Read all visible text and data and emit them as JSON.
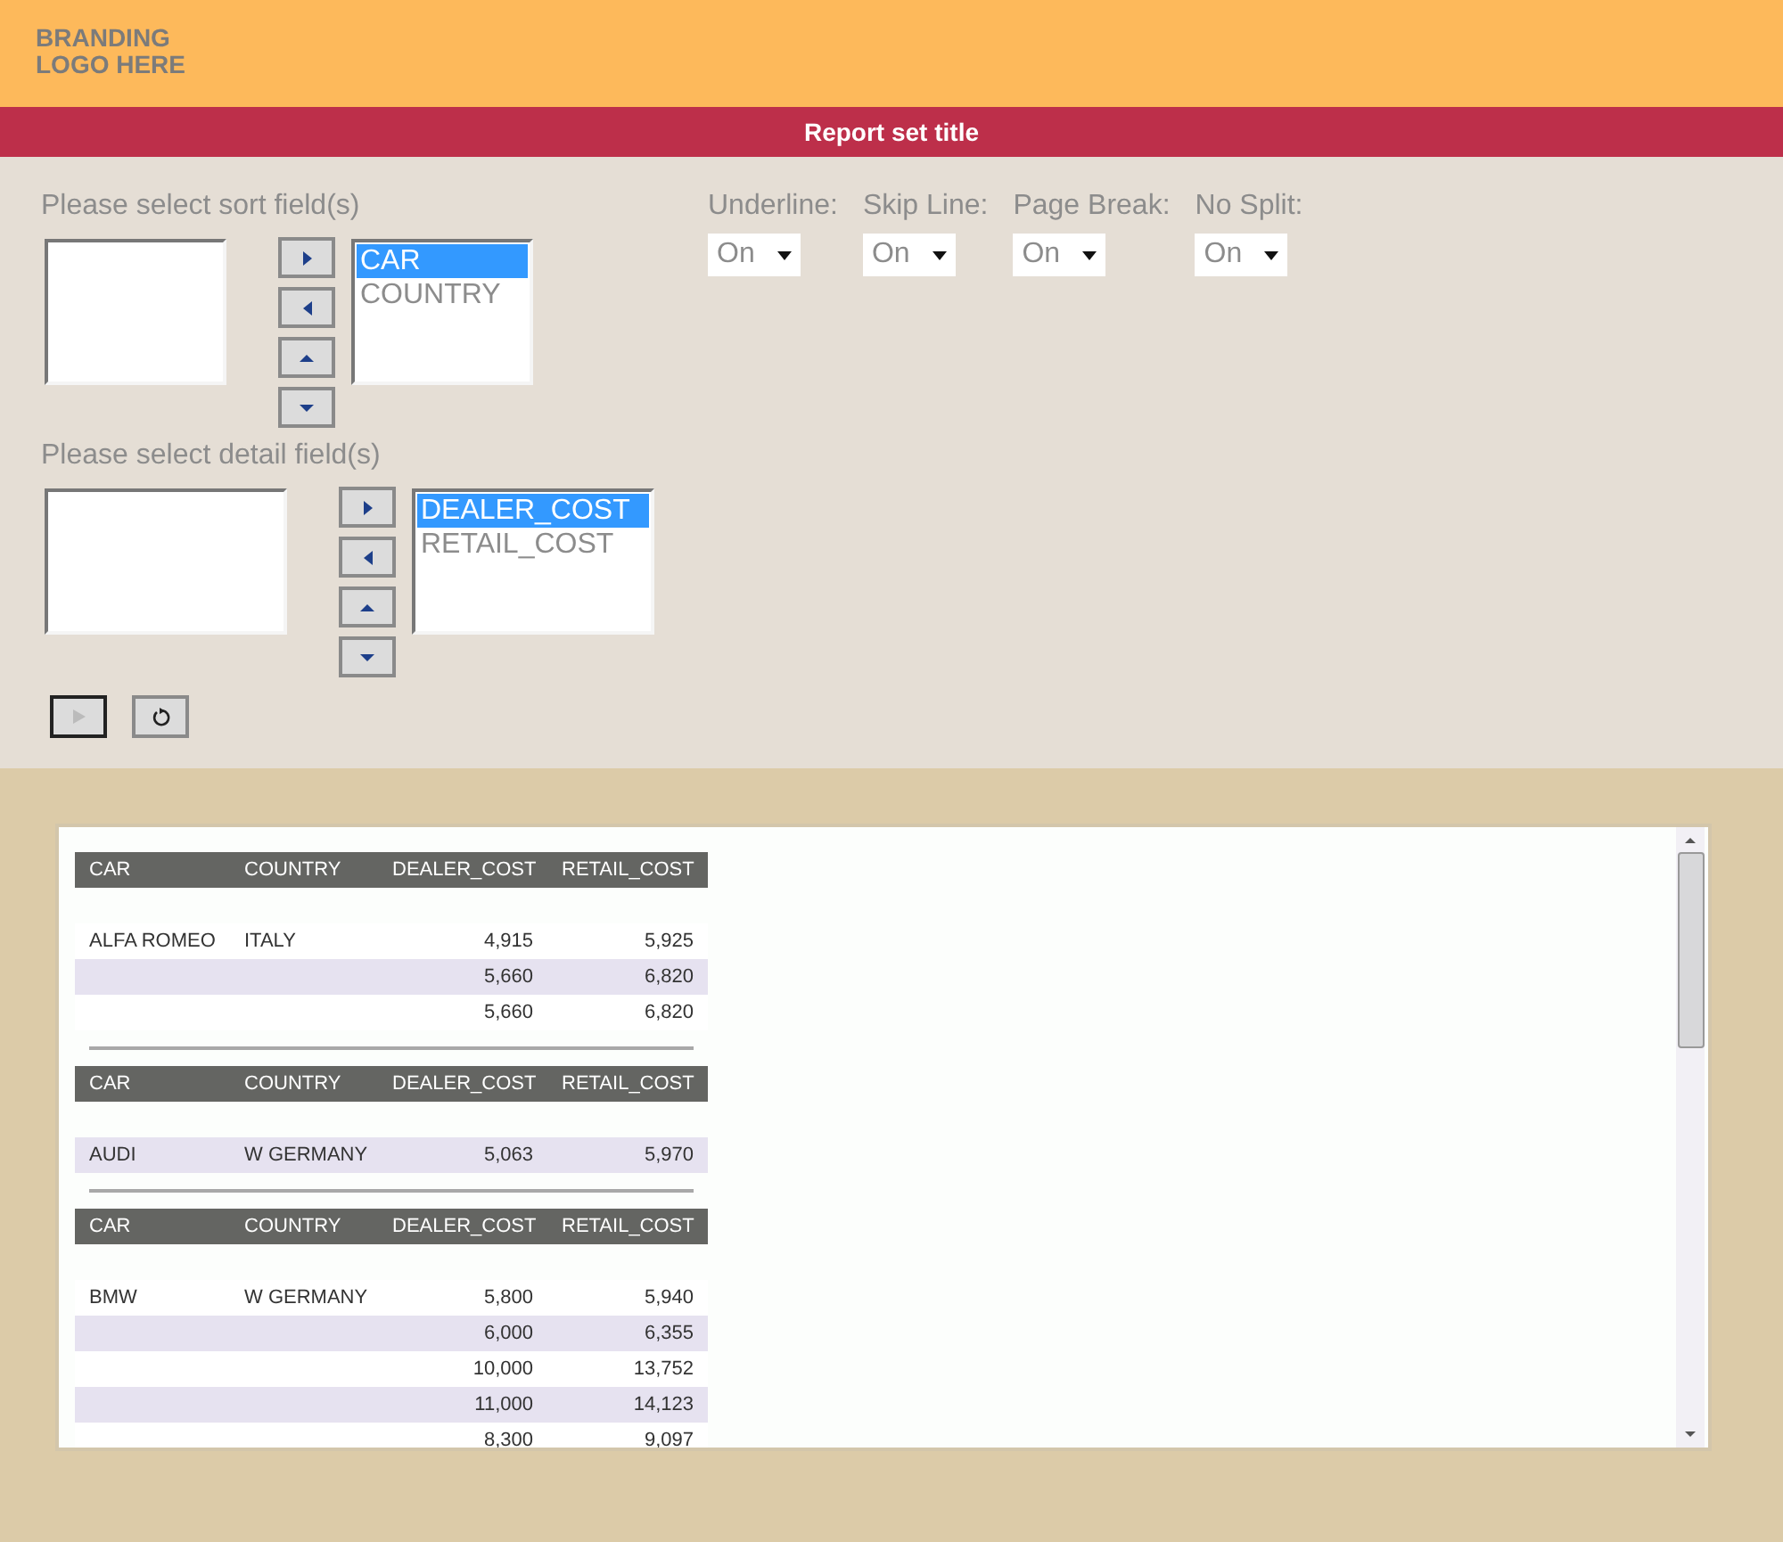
{
  "branding": {
    "line_1": "BRANDING",
    "line_2": "LOGO HERE"
  },
  "title": "Report set title",
  "sort_fields": {
    "label": "Please select sort field(s)",
    "selected_options": [
      {
        "label": "CAR",
        "selected": true
      },
      {
        "label": "COUNTRY",
        "selected": false
      }
    ]
  },
  "options": [
    {
      "label": "Underline:",
      "value": "On"
    },
    {
      "label": "Skip Line:",
      "value": "On"
    },
    {
      "label": "Page Break:",
      "value": "On"
    },
    {
      "label": "No Split:",
      "value": "On"
    }
  ],
  "detail_fields": {
    "label": "Please select detail field(s)",
    "selected_options": [
      {
        "label": "DEALER_COST",
        "selected": true
      },
      {
        "label": "RETAIL_COST",
        "selected": false
      }
    ]
  },
  "report": {
    "groups": [
      {
        "columns": [
          "CAR",
          "COUNTRY",
          "DEALER_COST",
          "RETAIL_COST"
        ],
        "rows": [
          {
            "cells": [
              "ALFA ROMEO",
              "ITALY",
              "4,915",
              "5,925"
            ],
            "shaded": false
          },
          {
            "cells": [
              "",
              "",
              "5,660",
              "6,820"
            ],
            "shaded": true
          },
          {
            "cells": [
              "",
              "",
              "5,660",
              "6,820"
            ],
            "shaded": false
          }
        ]
      },
      {
        "columns": [
          "CAR",
          "COUNTRY",
          "DEALER_COST",
          "RETAIL_COST"
        ],
        "rows": [
          {
            "cells": [
              "AUDI",
              "W GERMANY",
              "5,063",
              "5,970"
            ],
            "shaded": true
          }
        ]
      },
      {
        "columns": [
          "CAR",
          "COUNTRY",
          "DEALER_COST",
          "RETAIL_COST"
        ],
        "rows": [
          {
            "cells": [
              "BMW",
              "W GERMANY",
              "5,800",
              "5,940"
            ],
            "shaded": false
          },
          {
            "cells": [
              "",
              "",
              "6,000",
              "6,355"
            ],
            "shaded": true
          },
          {
            "cells": [
              "",
              "",
              "10,000",
              "13,752"
            ],
            "shaded": false
          },
          {
            "cells": [
              "",
              "",
              "11,000",
              "14,123"
            ],
            "shaded": true
          },
          {
            "cells": [
              "",
              "",
              "8,300",
              "9,097"
            ],
            "shaded": false
          }
        ]
      }
    ]
  }
}
